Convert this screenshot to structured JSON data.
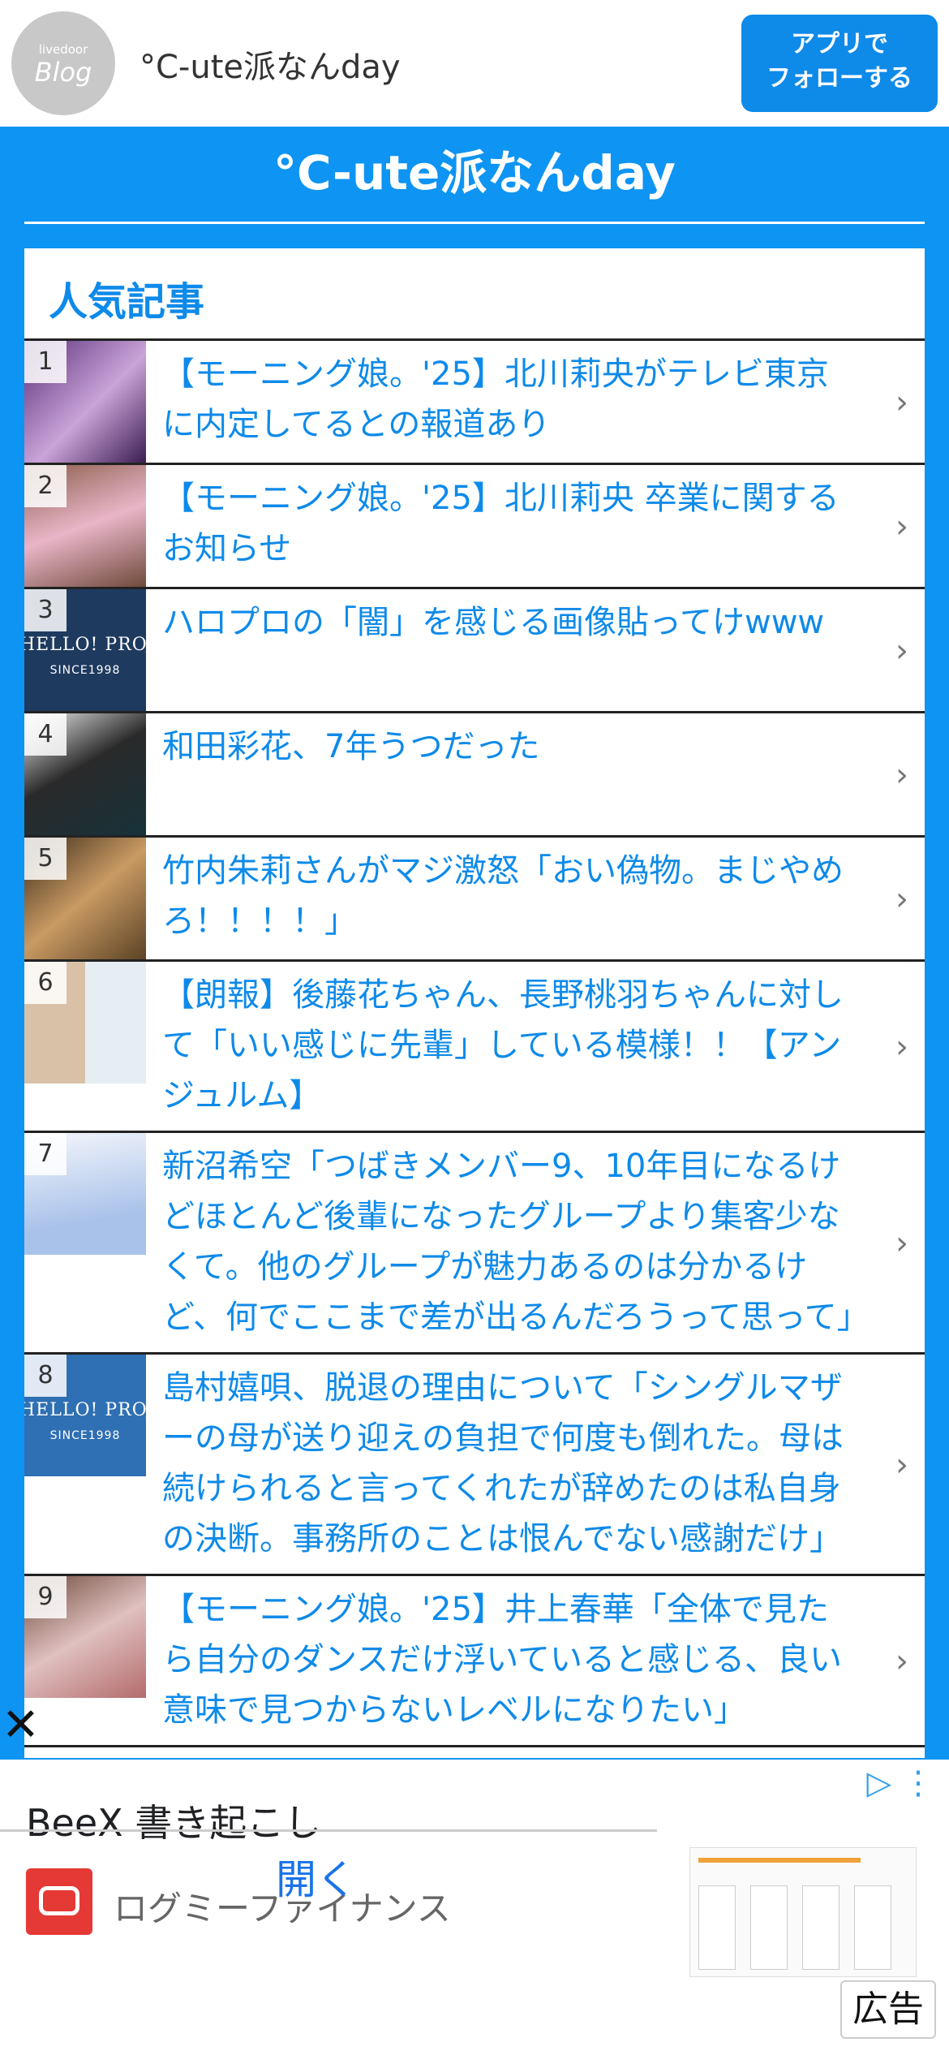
{
  "header": {
    "logo_small": "livedoor",
    "logo_big": "Blog",
    "site_name": "°C-ute派なんday",
    "follow_line1": "アプリで",
    "follow_line2": "フォローする"
  },
  "blog_title": "°C-ute派なんday",
  "popular": {
    "heading": "人気記事",
    "items": [
      {
        "rank": "1",
        "title": "【モーニング娘。'25】北川莉央がテレビ東京に内定してるとの報道あり"
      },
      {
        "rank": "2",
        "title": "【モーニング娘。'25】北川莉央 卒業に関するお知らせ"
      },
      {
        "rank": "3",
        "title": "ハロプロの「闇」を感じる画像貼ってけwww",
        "thumb_text": "HELLO! PROJECT",
        "thumb_sub": "SINCE1998"
      },
      {
        "rank": "4",
        "title": "和田彩花、7年うつだった"
      },
      {
        "rank": "5",
        "title": "竹内朱莉さんがマジ激怒「おい偽物。まじやめろ！！！！」"
      },
      {
        "rank": "6",
        "title": "【朗報】後藤花ちゃん、長野桃羽ちゃんに対して「いい感じに先輩」している模様！！【アンジュルム】"
      },
      {
        "rank": "7",
        "title": "新沼希空「つばきメンバー9、10年目になるけどほとんど後輩になったグループより集客少なくて。他のグループが魅力あるのは分かるけど、何でここまで差が出るんだろうって思って」"
      },
      {
        "rank": "8",
        "title": "島村嬉唄、脱退の理由について「シングルマザーの母が送り迎えの負担で何度も倒れた。母は続けられると言ってくれたが辞めたのは私自身の決断。事務所のことは恨んでない感謝だけ」",
        "thumb_text": "HELLO! PROJECT",
        "thumb_sub": "SINCE1998"
      },
      {
        "rank": "9",
        "title": "【モーニング娘。'25】井上春華「全体で見たら自分のダンスだけ浮いていると感じる、良い意味で見つからないレベルになりたい」"
      }
    ]
  },
  "ad": {
    "title": "BeeX 書き起こし",
    "advertiser": "ログミーファイナンス",
    "open_label": "開く",
    "ad_label": "広告",
    "close_glyph": "✕"
  },
  "colors": {
    "brand_blue": "#0e94f3",
    "link_blue": "#0e8ae9"
  }
}
